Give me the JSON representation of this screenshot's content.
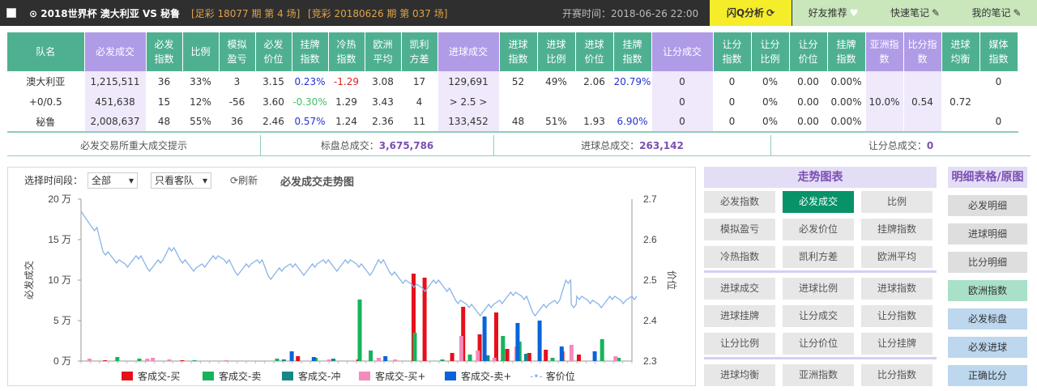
{
  "topbar": {
    "match": "⊙ 2018世界杯   澳大利亚  VS 秘鲁",
    "lottery1": "[足彩 18077 期 第 4 场]",
    "lottery2": "[竞彩 20180626 期 第 037 场]",
    "kickoff": "开赛时间：2018-06-26 22:00",
    "buttons": [
      "闪Q分析",
      "好友推荐",
      "快速笔记",
      "我的笔记"
    ]
  },
  "table": {
    "headers": [
      "队名",
      "必发成交",
      "必发指数",
      "比例",
      "模拟盈亏",
      "必发价位",
      "挂牌指数",
      "冷热指数",
      "欧洲平均",
      "凯利方差",
      "进球成交",
      "进球指数",
      "进球比例",
      "进球价位",
      "挂牌指数",
      "让分成交",
      "让分指数",
      "让分比例",
      "让分价位",
      "挂牌指数",
      "亚洲指数",
      "比分指数",
      "进球均衡",
      "媒体指数"
    ],
    "rows": [
      [
        "澳大利亚",
        "1,215,511",
        "36",
        "33%",
        "3",
        "3.15",
        "0.23%",
        "-1.29",
        "3.08",
        "17",
        "129,691",
        "52",
        "49%",
        "2.06",
        "20.79%",
        "0",
        "0",
        "0%",
        "0.00",
        "0.00%",
        "",
        "",
        "",
        "0"
      ],
      [
        "+0/0.5",
        "451,638",
        "15",
        "12%",
        "-56",
        "3.60",
        "-0.30%",
        "1.29",
        "3.43",
        "4",
        "> 2.5 >",
        "",
        "",
        "",
        "",
        "0",
        "0",
        "0%",
        "0.00",
        "0.00%",
        "10.0%",
        "0.54",
        "0.72",
        ""
      ],
      [
        "秘鲁",
        "2,008,637",
        "48",
        "55%",
        "36",
        "2.46",
        "0.57%",
        "1.24",
        "2.36",
        "11",
        "133,452",
        "48",
        "51%",
        "1.93",
        "6.90%",
        "0",
        "0",
        "0%",
        "0.00",
        "0.00%",
        "",
        "",
        "",
        "0"
      ]
    ]
  },
  "summary": {
    "big_trade": "必发交易所重大成交提示",
    "total_label": "标盘总成交：",
    "total": "3,675,786",
    "goal_label": "进球总成交：",
    "goal": "263,142",
    "hcp_label": "让分总成交：",
    "hcp": "0"
  },
  "chart_controls": {
    "time_label": "选择时间段：",
    "time_value": "全部",
    "team_value": "只看客队",
    "refresh": "刷新",
    "title": "必发成交走势图"
  },
  "chart_data": {
    "type": "bar",
    "title": "必发成交走势图",
    "ylabel_left": "必发成交",
    "ylabel_right": "价位",
    "left_ticks": [
      "20 万",
      "15 万",
      "10 万",
      "5 万",
      "0 万"
    ],
    "right_ticks": [
      "2.7",
      "2.6",
      "2.5",
      "2.4",
      "2.3"
    ],
    "ylim_left": [
      0,
      200000
    ],
    "ylim_right": [
      2.3,
      2.7
    ],
    "series": [
      {
        "name": "客成交-买",
        "color": "#e5101b",
        "values": [
          [
            0.04,
            1000
          ],
          [
            0.18,
            1000
          ],
          [
            0.26,
            500
          ],
          [
            0.39,
            6000
          ],
          [
            0.42,
            4000
          ],
          [
            0.5,
            2000
          ],
          [
            0.6,
            108000
          ],
          [
            0.62,
            103000
          ],
          [
            0.67,
            10000
          ],
          [
            0.69,
            67000
          ],
          [
            0.72,
            33000
          ],
          [
            0.75,
            60000
          ],
          [
            0.77,
            15000
          ],
          [
            0.79,
            22000
          ],
          [
            0.81,
            10000
          ],
          [
            0.84,
            14000
          ],
          [
            0.87,
            12000
          ],
          [
            0.9,
            8000
          ]
        ]
      },
      {
        "name": "客成交-卖",
        "color": "#16b35c",
        "values": [
          [
            0.06,
            5000
          ],
          [
            0.1,
            3000
          ],
          [
            0.2,
            1000
          ],
          [
            0.35,
            3000
          ],
          [
            0.42,
            4000
          ],
          [
            0.5,
            76000
          ],
          [
            0.52,
            13000
          ],
          [
            0.6,
            35000
          ],
          [
            0.65,
            2000
          ],
          [
            0.7,
            8000
          ],
          [
            0.76,
            31000
          ],
          [
            0.79,
            24000
          ],
          [
            0.85,
            4000
          ],
          [
            0.94,
            27000
          ],
          [
            0.97,
            4000
          ]
        ]
      },
      {
        "name": "客成交-冲",
        "color": "#13878a",
        "values": [
          [
            0.36,
            2000
          ],
          [
            0.45,
            3000
          ],
          [
            0.73,
            7000
          ],
          [
            0.8,
            9000
          ]
        ]
      },
      {
        "name": "客成交-买+",
        "color": "#f48bba",
        "values": [
          [
            0.005,
            3000
          ],
          [
            0.11,
            3000
          ],
          [
            0.12,
            4000
          ],
          [
            0.15,
            2000
          ],
          [
            0.44,
            2000
          ],
          [
            0.53,
            4000
          ],
          [
            0.56,
            2000
          ],
          [
            0.68,
            31000
          ],
          [
            0.71,
            13000
          ],
          [
            0.74,
            4000
          ],
          [
            0.78,
            18000
          ],
          [
            0.88,
            20000
          ],
          [
            0.96,
            6000
          ]
        ]
      },
      {
        "name": "客成交-卖+",
        "color": "#0a64d8",
        "values": [
          [
            0.37,
            12000
          ],
          [
            0.41,
            5000
          ],
          [
            0.54,
            6000
          ],
          [
            0.72,
            55000
          ],
          [
            0.78,
            47000
          ],
          [
            0.82,
            50000
          ],
          [
            0.86,
            18000
          ],
          [
            0.92,
            12000
          ]
        ]
      }
    ],
    "line": {
      "name": "客价位",
      "color": "#88b4e8",
      "values": [
        [
          0.0,
          2.67
        ],
        [
          0.02,
          2.63
        ],
        [
          0.04,
          2.57
        ],
        [
          0.06,
          2.55
        ],
        [
          0.08,
          2.54
        ],
        [
          0.1,
          2.56
        ],
        [
          0.12,
          2.53
        ],
        [
          0.14,
          2.55
        ],
        [
          0.16,
          2.58
        ],
        [
          0.18,
          2.55
        ],
        [
          0.2,
          2.53
        ],
        [
          0.22,
          2.54
        ],
        [
          0.24,
          2.56
        ],
        [
          0.26,
          2.55
        ],
        [
          0.28,
          2.52
        ],
        [
          0.3,
          2.54
        ],
        [
          0.32,
          2.55
        ],
        [
          0.34,
          2.51
        ],
        [
          0.36,
          2.53
        ],
        [
          0.38,
          2.54
        ],
        [
          0.4,
          2.52
        ],
        [
          0.42,
          2.54
        ],
        [
          0.44,
          2.55
        ],
        [
          0.46,
          2.53
        ],
        [
          0.48,
          2.55
        ],
        [
          0.5,
          2.54
        ],
        [
          0.52,
          2.52
        ],
        [
          0.54,
          2.55
        ],
        [
          0.56,
          2.52
        ],
        [
          0.58,
          2.5
        ],
        [
          0.6,
          2.49
        ],
        [
          0.62,
          2.48
        ],
        [
          0.64,
          2.5
        ],
        [
          0.66,
          2.48
        ],
        [
          0.68,
          2.45
        ],
        [
          0.7,
          2.44
        ],
        [
          0.72,
          2.42
        ],
        [
          0.74,
          2.44
        ],
        [
          0.76,
          2.45
        ],
        [
          0.78,
          2.47
        ],
        [
          0.8,
          2.46
        ],
        [
          0.82,
          2.42
        ],
        [
          0.84,
          2.44
        ],
        [
          0.86,
          2.45
        ],
        [
          0.88,
          2.5
        ],
        [
          0.89,
          2.44
        ],
        [
          0.9,
          2.46
        ],
        [
          0.92,
          2.45
        ],
        [
          0.94,
          2.44
        ],
        [
          0.96,
          2.46
        ],
        [
          0.98,
          2.45
        ],
        [
          1.0,
          2.46
        ]
      ]
    }
  },
  "legend": [
    "客成交-买",
    "客成交-卖",
    "客成交-冲",
    "客成交-买+",
    "客成交-卖+",
    "客价位"
  ],
  "right_panel": {
    "trend_title": "走势图表",
    "trend_rows": [
      [
        "必发指数",
        "必发成交",
        "比例"
      ],
      [
        "模拟盈亏",
        "必发价位",
        "挂牌指数"
      ],
      [
        "冷热指数",
        "凯利方差",
        "欧洲平均"
      ],
      [
        "进球成交",
        "进球比例",
        "进球指数"
      ],
      [
        "进球挂牌",
        "让分成交",
        "让分指数"
      ],
      [
        "让分比例",
        "让分价位",
        "让分挂牌"
      ],
      [
        "进球均衡",
        "亚洲指数",
        "比分指数"
      ]
    ],
    "detail_title": "明细表格/原图",
    "detail_buttons": [
      "必发明细",
      "进球明细",
      "比分明细",
      "欧洲指数",
      "必发标盘",
      "必发进球",
      "正确比分"
    ]
  }
}
